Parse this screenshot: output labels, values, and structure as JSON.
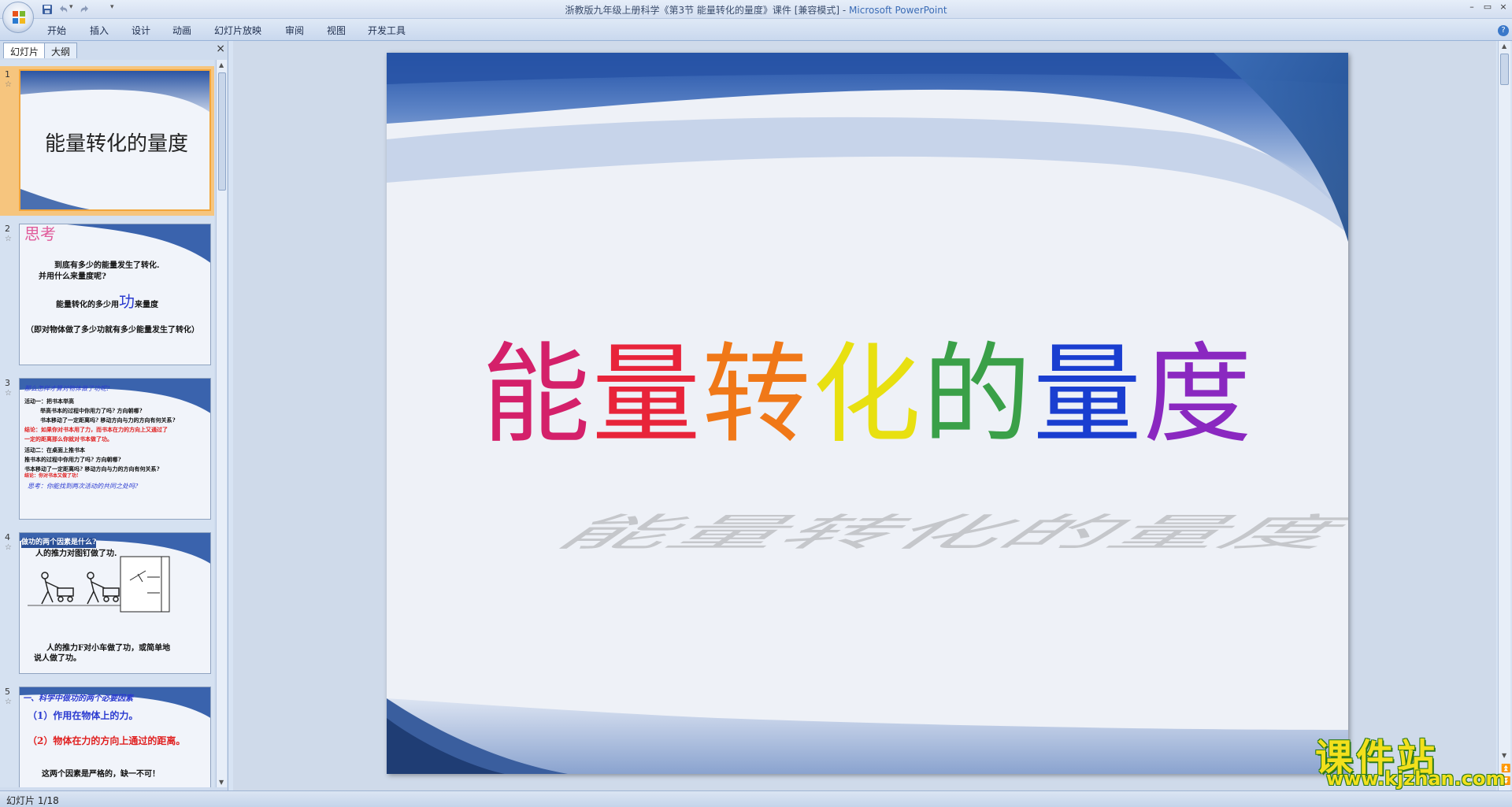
{
  "window": {
    "title": "浙教版九年级上册科学《第3节 能量转化的量度》课件 [兼容模式] - ",
    "app_name": "Microsoft PowerPoint",
    "min_label": "–",
    "restore_label": "▭",
    "close_label": "×"
  },
  "ribbon": {
    "tabs": [
      "开始",
      "插入",
      "设计",
      "动画",
      "幻灯片放映",
      "审阅",
      "视图",
      "开发工具"
    ],
    "help": "?"
  },
  "panel": {
    "tabs": [
      "幻灯片",
      "大纲"
    ],
    "close": "×"
  },
  "thumbnails": [
    {
      "num": "1",
      "title": "能量转化的量度"
    },
    {
      "num": "2",
      "heading": "思考",
      "line1": "到底有多少的能量发生了转化.",
      "line2": "并用什么来量度呢?",
      "line3a": "能量转化的多少用",
      "line3b": "功",
      "line3c": "来量度",
      "line4": "（即对物体做了多少功就有多少能量发生了转化）"
    },
    {
      "num": "3",
      "lines": [
        "那么怎样才算对物体做了功呢?",
        "活动一：把书本举高",
        "举高书本的过程中你用力了吗? 方向朝哪?",
        "书本移动了一定距离吗? 移动方向与力的方向有何关系?",
        "结论：如果你对书本用了力，而书本在力的方向上又通过了",
        "一定的距离那么你就对书本做了功。",
        "活动二：在桌面上推书本",
        "推书本的过程中你用力了吗? 方向朝哪?",
        "书本移动了一定距离吗? 移动方向与力的方向有何关系?",
        "结论：你对书本又做了功!",
        "思考：你能找到两次活动的共同之处吗?"
      ]
    },
    {
      "num": "4",
      "heading": "做功的两个因素是什么?",
      "line1": "人的推力对图钉做了功.",
      "line2": "人的推力F对小车做了功，或简单地",
      "line3": "说人做了功。"
    },
    {
      "num": "5",
      "heading": "一、科学中做功的两个必要因素",
      "line1": "（1）作用在物体上的力。",
      "line2": "（2）物体在力的方向上通过的距离。",
      "line3": "这两个因素是严格的，缺一不可！"
    }
  ],
  "slide": {
    "title_chars": [
      "能",
      "量",
      "转",
      "化",
      "的",
      "量",
      "度"
    ],
    "title_colors": [
      "#d4206a",
      "#e8243a",
      "#f07818",
      "#e8e010",
      "#3aa048",
      "#1a3ed0",
      "#8a28c0"
    ]
  },
  "status": {
    "text": "幻灯片 1/18"
  },
  "watermark": {
    "main": "课件站",
    "url": "www.kjzhan.com"
  }
}
